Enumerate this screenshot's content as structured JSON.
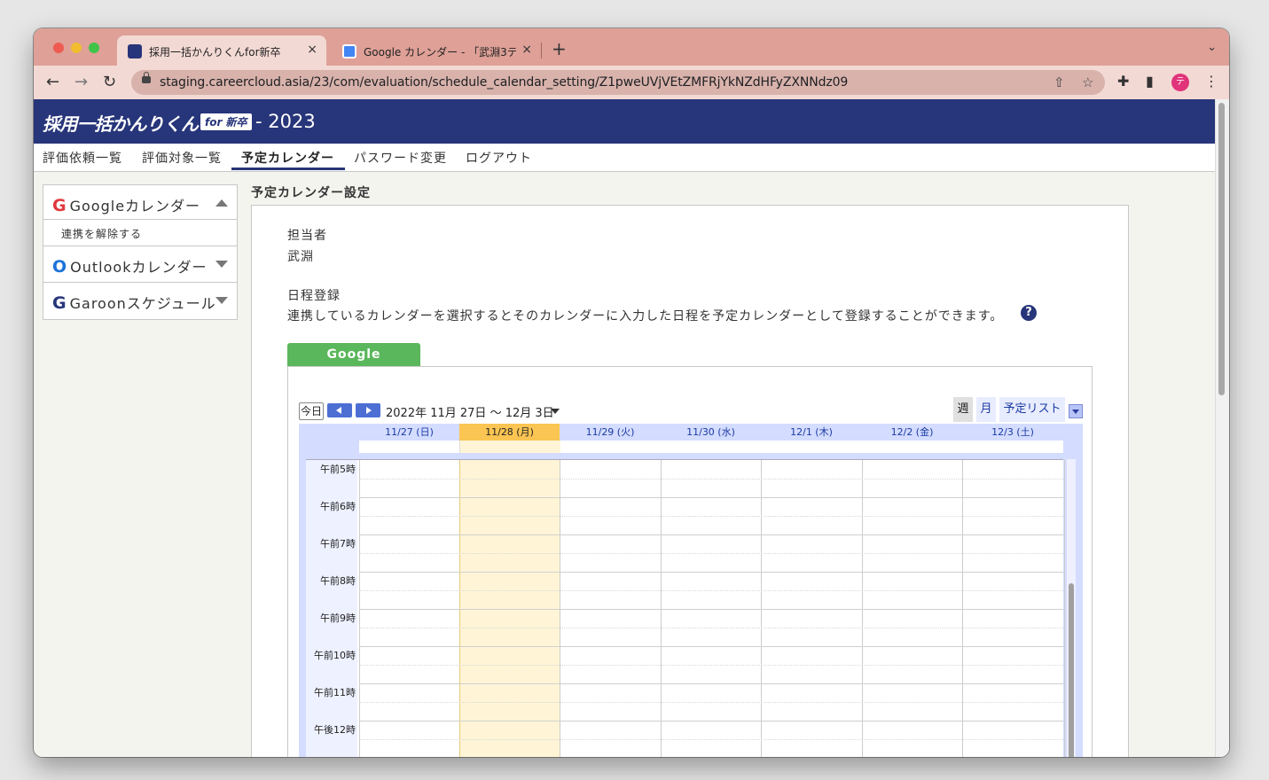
{
  "browser": {
    "tabs": [
      {
        "title": "採用一括かんりくんfor新卒",
        "active": true,
        "close": "×"
      },
      {
        "title": "Google カレンダー - 「武淵3テス",
        "active": false,
        "close": "×"
      }
    ],
    "new_tab": "+",
    "tab_menu": "⌄",
    "url": "staging.careercloud.asia/23/com/evaluation/schedule_calendar_setting/Z1pweUVjVEtZMFRjYkNZdHFyZXNNdz09",
    "profile_initial": "テ",
    "nav": {
      "back": "←",
      "forward": "→",
      "reload": "↻"
    },
    "icons": {
      "share": "⇧",
      "star": "☆",
      "extensions": "✚",
      "sidebar": "▮",
      "menu": "⋮"
    }
  },
  "header": {
    "logo_text": "採用一括かんりくん",
    "logo_badge": "for 新卒",
    "year": "- 2023",
    "colors": {
      "header_bg": "#27357a"
    }
  },
  "nav": {
    "items": [
      {
        "label": "評価依頼一覧",
        "active": false
      },
      {
        "label": "評価対象一覧",
        "active": false
      },
      {
        "label": "予定カレンダー",
        "active": true
      },
      {
        "label": "パスワード変更",
        "active": false
      },
      {
        "label": "ログアウト",
        "active": false
      }
    ]
  },
  "sidebar": {
    "google": {
      "icon": "G",
      "label": "Googleカレンダー",
      "link": "連携を解除する",
      "color": "#e0393e"
    },
    "outlook": {
      "icon": "O",
      "label": "Outlookカレンダー",
      "color": "#1e73d8"
    },
    "garoon": {
      "icon": "G",
      "label": "Garoonスケジュール",
      "color": "#27357a"
    }
  },
  "main": {
    "title": "予定カレンダー設定",
    "assignee_label": "担当者",
    "assignee_value": "武淵",
    "schedule_label": "日程登録",
    "schedule_desc": "連携しているカレンダーを選択するとそのカレンダーに入力した日程を予定カレンダーとして登録することができます。",
    "help": "?",
    "calendar_tab": "Google"
  },
  "calendar": {
    "today_button": "今日",
    "date_range": "2022年 11月 27日 〜 12月 3日",
    "views": {
      "week": "週",
      "month": "月",
      "agenda": "予定リスト"
    },
    "days": [
      {
        "label": "11/27 (日)",
        "today": false
      },
      {
        "label": "11/28 (月)",
        "today": true
      },
      {
        "label": "11/29 (火)",
        "today": false
      },
      {
        "label": "11/30 (水)",
        "today": false
      },
      {
        "label": "12/1 (木)",
        "today": false
      },
      {
        "label": "12/2 (金)",
        "today": false
      },
      {
        "label": "12/3 (土)",
        "today": false
      }
    ],
    "hours": [
      "午前5時",
      "午前6時",
      "午前7時",
      "午前8時",
      "午前9時",
      "午前10時",
      "午前11時",
      "午後12時"
    ],
    "colors": {
      "today_header": "#fac552",
      "today_column": "#fff5d6",
      "nav_button": "#4d6fd4"
    }
  }
}
